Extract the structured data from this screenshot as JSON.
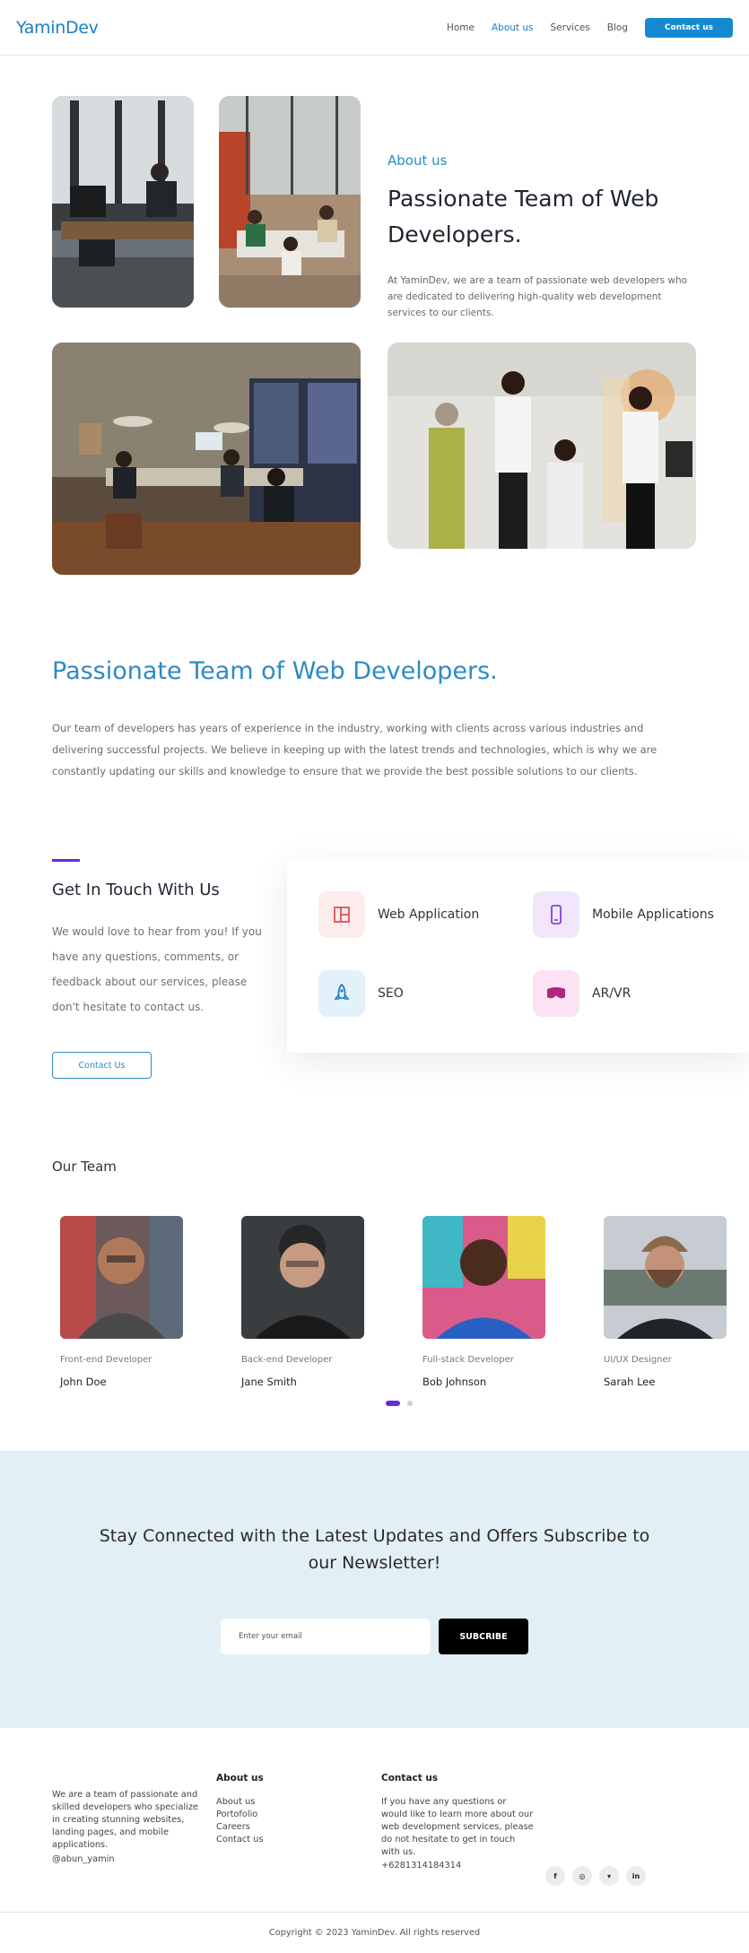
{
  "header": {
    "logo": "YaminDev",
    "nav": [
      "Home",
      "About us",
      "Services",
      "Blog"
    ],
    "contact_button": "Contact us"
  },
  "about": {
    "eyebrow": "About us",
    "title": "Passionate Team of Web Developers.",
    "description": "At YaminDev, we are a team of passionate web developers who are dedicated to delivering high-quality web development services to our clients."
  },
  "passionate": {
    "title": "Passionate Team of Web Developers.",
    "description": "Our team of developers has years of experience in the industry, working with clients across various industries and delivering successful projects. We believe in keeping up with the latest trends and technologies, which is why we are constantly updating our skills and knowledge to ensure that we provide the best possible solutions to our clients."
  },
  "get_in_touch": {
    "title": "Get In Touch With Us",
    "description": "We would love to hear from you! If you have any questions, comments, or feedback about our services, please don't hesitate to contact us.",
    "button": "Contact Us"
  },
  "services": [
    {
      "label": "Web Application",
      "icon": "layout-icon",
      "color": "#e0524f",
      "bg": "#fdecec"
    },
    {
      "label": "Mobile Applications",
      "icon": "mobile-icon",
      "color": "#8a3fd6",
      "bg": "#f1e6fb"
    },
    {
      "label": "SEO",
      "icon": "rocket-icon",
      "color": "#1f7fc7",
      "bg": "#e3f1fb"
    },
    {
      "label": "AR/VR",
      "icon": "vr-headset-icon",
      "color": "#b0267d",
      "bg": "#fbe3f3"
    }
  ],
  "team": {
    "title": "Our Team",
    "members": [
      {
        "role": "Front-end Developer",
        "name": "John Doe"
      },
      {
        "role": "Back-end Developer",
        "name": "Jane Smith"
      },
      {
        "role": "Full-stack Developer",
        "name": "Bob Johnson"
      },
      {
        "role": "UI/UX Designer",
        "name": "Sarah Lee"
      }
    ]
  },
  "newsletter": {
    "title": "Stay Connected with the Latest Updates and Offers Subscribe to our Newsletter!",
    "placeholder": "Enter your email",
    "button": "SUBCRIBE"
  },
  "footer": {
    "description": "We are a team of passionate and skilled developers who specialize in creating stunning websites, landing pages, and mobile applications.",
    "handle": "@abun_yamin",
    "about_title": "About us",
    "about_links": [
      "About us",
      "Portofolio",
      "Careers",
      "Contact us"
    ],
    "contact_title": "Contact us",
    "contact_text": "If you have any questions or would like to learn more about our web development services, please do not hesitate to get in touch with us.",
    "phone": "+6281314184314",
    "socials": [
      "f",
      "◎",
      "▾",
      "in"
    ],
    "copyright": "Copyright © 2023 YaminDev. All rights reserved"
  }
}
